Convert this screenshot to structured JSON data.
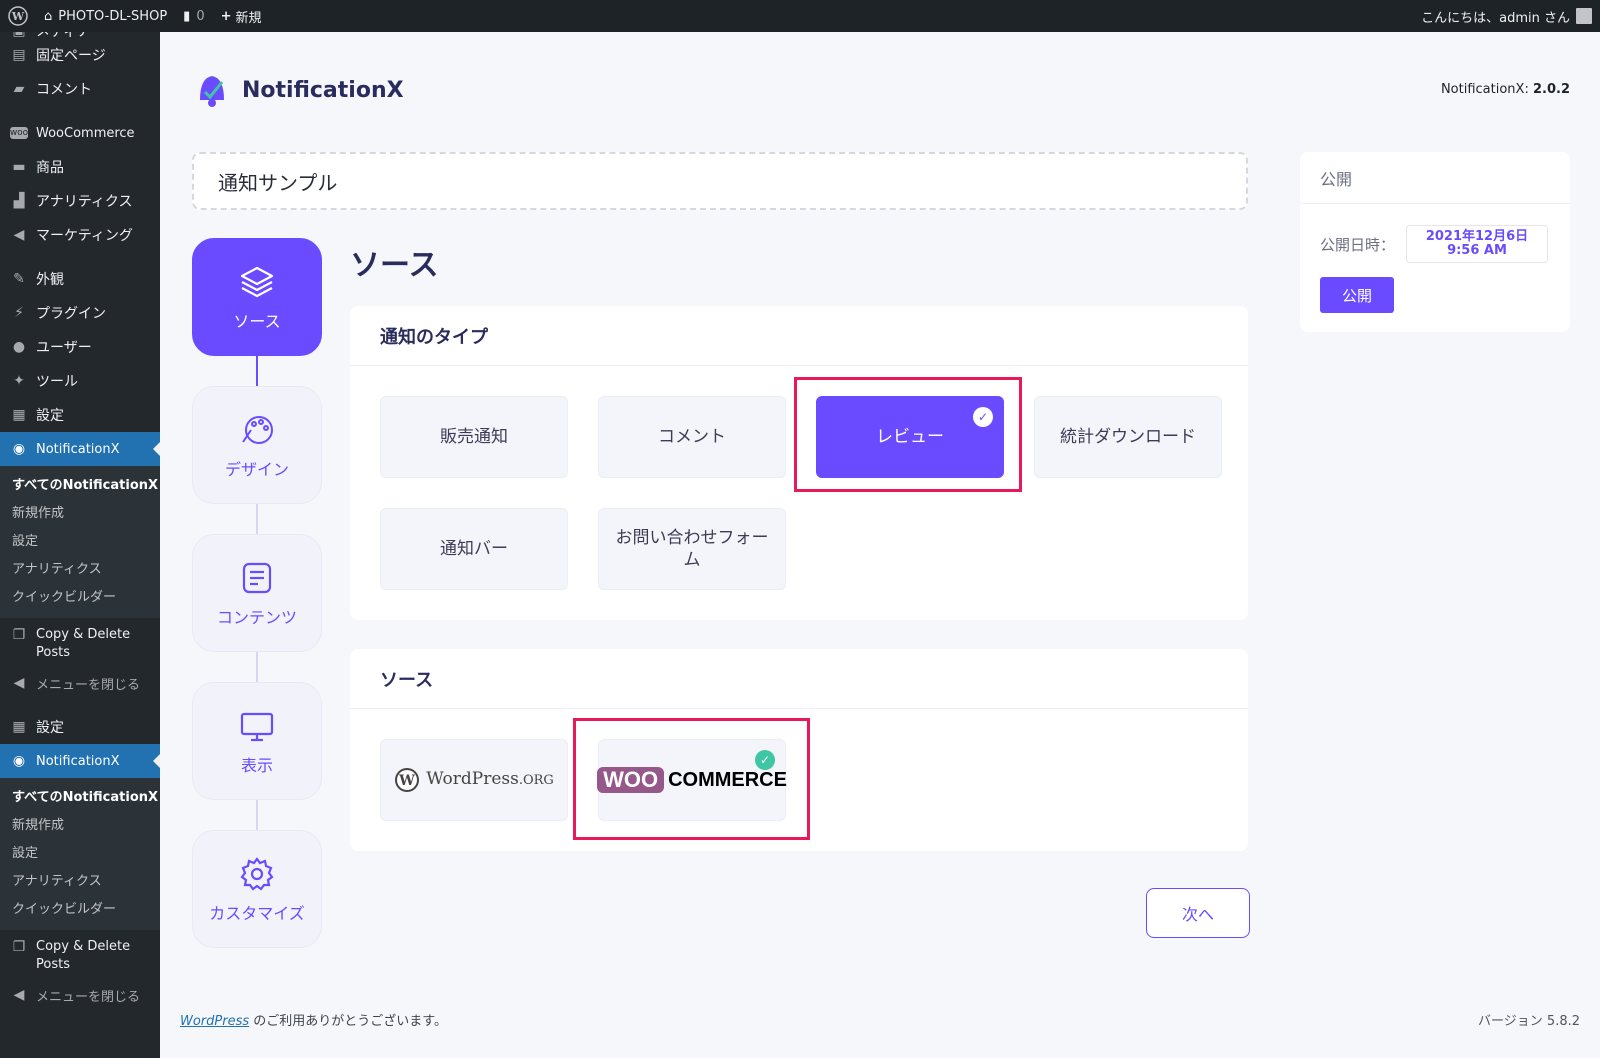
{
  "adminbar": {
    "site_name": "PHOTO-DL-SHOP",
    "comments_count": "0",
    "new_label": "新規",
    "greeting": "こんにちは、admin さん"
  },
  "sidebar": {
    "top_partial": "メディア",
    "items": [
      {
        "label": "固定ページ",
        "icon": "page-icon"
      },
      {
        "label": "コメント",
        "icon": "comment-icon"
      },
      {
        "label": "WooCommerce",
        "icon": "woo-icon"
      },
      {
        "label": "商品",
        "icon": "products-icon"
      },
      {
        "label": "アナリティクス",
        "icon": "chart-icon"
      },
      {
        "label": "マーケティング",
        "icon": "megaphone-icon"
      },
      {
        "label": "外観",
        "icon": "brush-icon"
      },
      {
        "label": "プラグイン",
        "icon": "plugin-icon"
      },
      {
        "label": "ユーザー",
        "icon": "user-icon"
      },
      {
        "label": "ツール",
        "icon": "wrench-icon"
      },
      {
        "label": "設定",
        "icon": "settings-icon"
      }
    ],
    "nx_label": "NotificationX",
    "nx_sub": [
      "すべてのNotificationX",
      "新規作成",
      "設定",
      "アナリティクス",
      "クイックビルダー"
    ],
    "copy_delete": "Copy & Delete Posts",
    "collapse": "メニューを閉じる",
    "settings2": "設定"
  },
  "header": {
    "logo_text": "NotificationX",
    "version_label": "NotificationX:",
    "version": "2.0.2"
  },
  "title_input": "通知サンプル",
  "steps": [
    "ソース",
    "デザイン",
    "コンテンツ",
    "表示",
    "カスタマイズ"
  ],
  "section_title": "ソース",
  "notification_type": {
    "heading": "通知のタイプ",
    "options": [
      "販売通知",
      "コメント",
      "レビュー",
      "統計ダウンロード",
      "通知バー",
      "お問い合わせフォーム"
    ]
  },
  "source": {
    "heading": "ソース",
    "wp_label": "WordPress.org",
    "wp_text": "WordPress",
    "wp_suffix": ".ORG",
    "woo_badge": "WOO",
    "woo_text": "COMMERCE"
  },
  "next_button": "次へ",
  "publish": {
    "heading": "公開",
    "date_label": "公開日時：",
    "date_line1": "2021年12月6日",
    "date_line2": "9:56 AM",
    "button": "公開"
  },
  "footer": {
    "link": "WordPress",
    "text": " のご利用ありがとうございます。",
    "version": "バージョン 5.8.2"
  },
  "colors": {
    "accent": "#6a4bff",
    "highlight": "#e8195a",
    "wp_admin_bar": "#1d2327",
    "sidebar": "#23282d",
    "current_menu": "#2271b1"
  }
}
